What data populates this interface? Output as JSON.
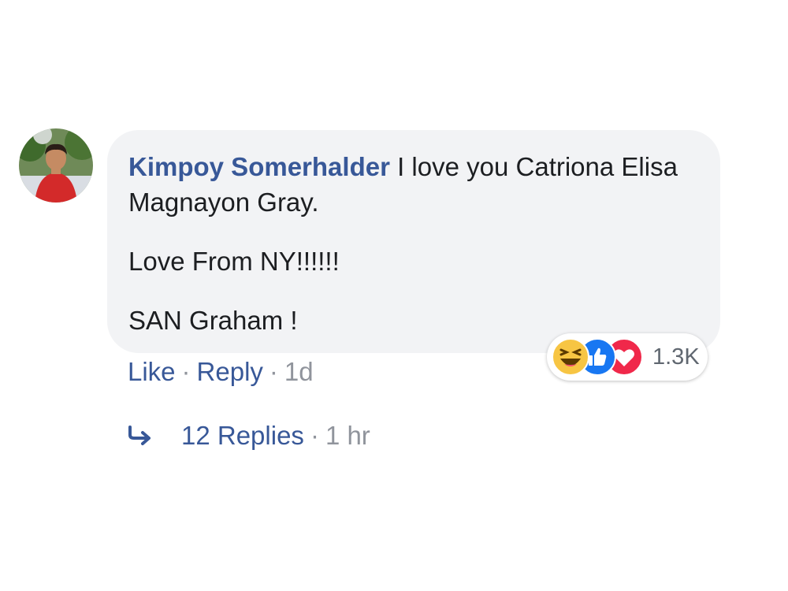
{
  "comment": {
    "author": "Kimpoy Somerhalder",
    "text_first": " I love you Catriona Elisa Magnayon Gray.",
    "text_second": "Love From NY!!!!!!",
    "text_third": "SAN Graham !"
  },
  "reactions": {
    "icons": [
      "haha-icon",
      "like-icon",
      "love-icon"
    ],
    "count": "1.3K"
  },
  "actions": {
    "like_label": "Like",
    "reply_label": "Reply",
    "time": "1d"
  },
  "replies": {
    "label": "12 Replies",
    "time": "1 hr"
  },
  "colors": {
    "link": "#385898",
    "bubble": "#f2f3f5",
    "meta": "#90949c"
  }
}
